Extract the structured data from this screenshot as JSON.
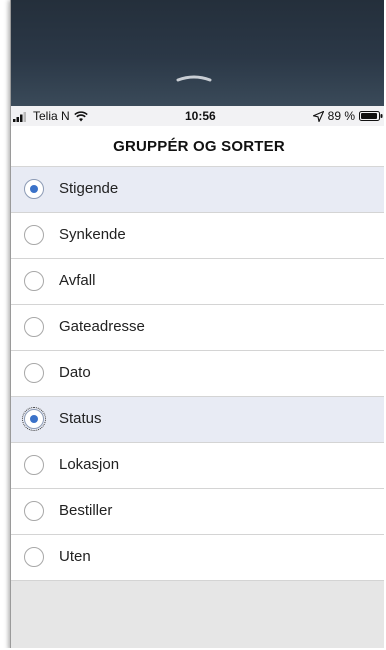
{
  "status_bar": {
    "carrier": "Telia N",
    "time": "10:56",
    "battery": "89 %"
  },
  "icons": {
    "signal": "signal-bars-icon",
    "wifi": "wifi-icon",
    "location": "location-arrow-icon",
    "battery": "battery-icon",
    "grabber": "sheet-grabber-icon"
  },
  "sheet": {
    "title": "GRUPPÉR OG SORTER"
  },
  "options": [
    {
      "label": "Stigende",
      "selected": true
    },
    {
      "label": "Synkende",
      "selected": false
    },
    {
      "label": "Avfall",
      "selected": false
    },
    {
      "label": "Gateadresse",
      "selected": false
    },
    {
      "label": "Dato",
      "selected": false
    },
    {
      "label": "Status",
      "selected": true
    },
    {
      "label": "Lokasjon",
      "selected": false
    },
    {
      "label": "Bestiller",
      "selected": false
    },
    {
      "label": "Uten",
      "selected": false
    }
  ],
  "colors": {
    "accent": "#3b72c9",
    "selected_row": "#e8ebf4",
    "backdrop": "#242f3b"
  }
}
